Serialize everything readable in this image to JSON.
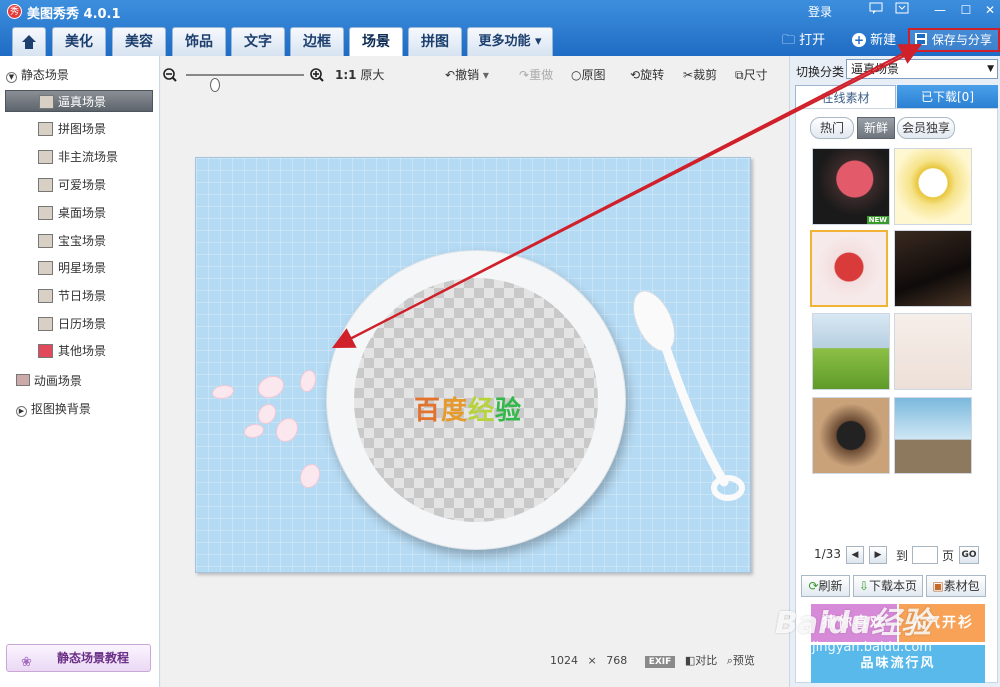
{
  "app": {
    "logo_char": "秀",
    "title": "美图秀秀 4.0.1",
    "login": "登录"
  },
  "window": {
    "feedback_icon": "feedback-icon",
    "menu_icon": "menu-icon",
    "minimize": "—",
    "maximize": "☐",
    "close": "✕"
  },
  "tabs": [
    {
      "label": "美化"
    },
    {
      "label": "美容"
    },
    {
      "label": "饰品"
    },
    {
      "label": "文字"
    },
    {
      "label": "边框"
    },
    {
      "label": "场景"
    },
    {
      "label": "拼图"
    },
    {
      "label": "更多功能"
    }
  ],
  "active_tab": "场景",
  "file_actions": {
    "open": "打开",
    "new": "新建",
    "save_share": "保存与分享"
  },
  "left": {
    "static_group": "静态场景",
    "items": [
      {
        "label": "逼真场景"
      },
      {
        "label": "拼图场景"
      },
      {
        "label": "非主流场景"
      },
      {
        "label": "可爱场景"
      },
      {
        "label": "桌面场景"
      },
      {
        "label": "宝宝场景"
      },
      {
        "label": "明星场景"
      },
      {
        "label": "节日场景"
      },
      {
        "label": "日历场景"
      },
      {
        "label": "其他场景"
      }
    ],
    "animated_group": "动画场景",
    "matting_group": "抠图换背景",
    "tutorial": "静态场景教程"
  },
  "canvas_toolbar": {
    "actual_size_ratio": "1:1",
    "actual_size": "原大",
    "undo": "撤销",
    "redo": "重做",
    "original": "原图",
    "rotate": "旋转",
    "crop": "裁剪",
    "resize": "尺寸"
  },
  "canvas": {
    "overlay_text": "百度经验"
  },
  "status": {
    "width": "1024",
    "times": "×",
    "height": "768",
    "exif": "EXIF",
    "compare": "对比",
    "preview": "预览"
  },
  "right": {
    "switch_label": "切换分类",
    "category": "逼真场景",
    "tabs": {
      "online": "在线素材",
      "downloaded": "已下载[0]"
    },
    "filters": [
      "热门",
      "新鲜",
      "会员独享"
    ],
    "new_badge": "NEW",
    "pager": {
      "current": "1/33",
      "goto": "到",
      "page": "页",
      "go": "GO"
    },
    "actions": {
      "refresh": "刷新",
      "download_page": "下载本页",
      "material_pack": "素材包"
    },
    "banners": {
      "guess": "猜你喜欢",
      "popular": "人气开衫",
      "third": "品味流行风"
    }
  },
  "watermark": {
    "brand": "Baidu经验",
    "url": "jingyan.baidu.com"
  },
  "colors": {
    "accent": "#2a7fd2",
    "highlight": "#d0202a",
    "selected_thumb": "#f0b333"
  }
}
